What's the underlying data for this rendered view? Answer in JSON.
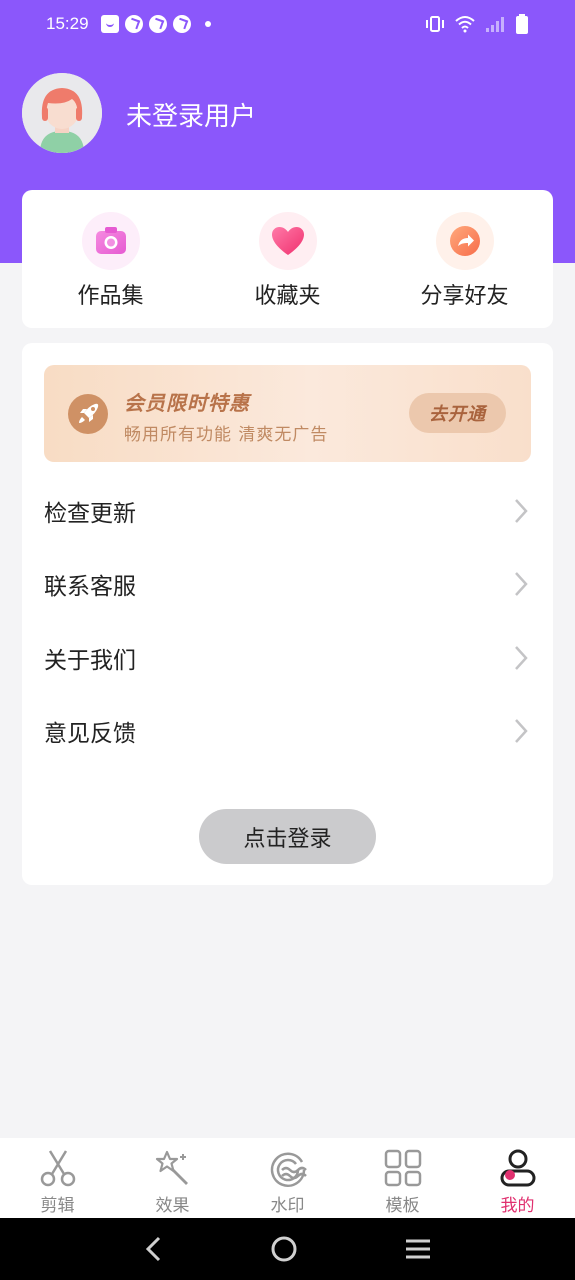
{
  "status_bar": {
    "time": "15:29"
  },
  "profile": {
    "username": "未登录用户"
  },
  "quick_actions": [
    {
      "label": "作品集",
      "icon": "camera-icon"
    },
    {
      "label": "收藏夹",
      "icon": "heart-icon"
    },
    {
      "label": "分享好友",
      "icon": "share-arrow-icon"
    }
  ],
  "vip": {
    "title": "会员限时特惠",
    "subtitle": "畅用所有功能 清爽无广告",
    "button": "去开通"
  },
  "menu": [
    {
      "label": "检查更新"
    },
    {
      "label": "联系客服"
    },
    {
      "label": "关于我们"
    },
    {
      "label": "意见反馈"
    }
  ],
  "login_button": "点击登录",
  "tabs": [
    {
      "label": "剪辑",
      "icon": "scissors-icon",
      "active": false
    },
    {
      "label": "效果",
      "icon": "magic-wand-icon",
      "active": false
    },
    {
      "label": "水印",
      "icon": "watermark-icon",
      "active": false
    },
    {
      "label": "模板",
      "icon": "grid-icon",
      "active": false
    },
    {
      "label": "我的",
      "icon": "user-icon",
      "active": true
    }
  ],
  "colors": {
    "header_purple": "#8b57fb",
    "active_tab": "#e0306f"
  }
}
